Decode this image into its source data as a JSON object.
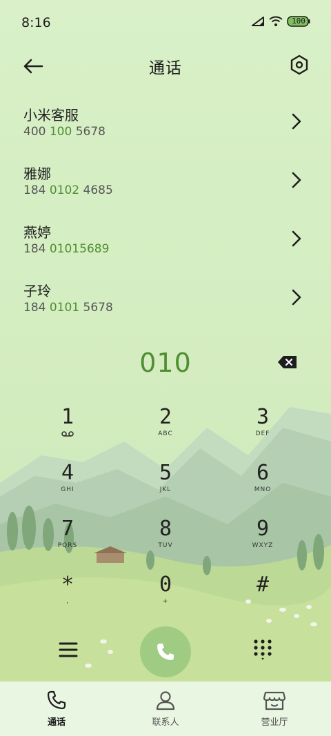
{
  "status_bar": {
    "time": "8:16",
    "battery": "100",
    "icons": [
      "signal-icon",
      "wifi-icon",
      "battery-icon"
    ]
  },
  "header": {
    "title": "通话",
    "back_icon": "arrow-left-icon",
    "settings_icon": "settings-hexagon-icon"
  },
  "contacts": [
    {
      "name": "小米客服",
      "number_pre": "400 ",
      "number_match": "100",
      "number_post": " 5678"
    },
    {
      "name": "雅娜",
      "number_pre": "184 ",
      "number_match": "0102",
      "number_post": " 4685"
    },
    {
      "name": "燕婷",
      "number_pre": "184 ",
      "number_match": "01015689",
      "number_post": ""
    },
    {
      "name": "子玲",
      "number_pre": "184 ",
      "number_match": "0101",
      "number_post": " 5678"
    }
  ],
  "dialer": {
    "number": "010",
    "keys": [
      {
        "digit": "1",
        "sub": ""
      },
      {
        "digit": "2",
        "sub": "ABC"
      },
      {
        "digit": "3",
        "sub": "DEF"
      },
      {
        "digit": "4",
        "sub": "GHI"
      },
      {
        "digit": "5",
        "sub": "JKL"
      },
      {
        "digit": "6",
        "sub": "MNO"
      },
      {
        "digit": "7",
        "sub": "PQRS"
      },
      {
        "digit": "8",
        "sub": "TUV"
      },
      {
        "digit": "9",
        "sub": "WXYZ"
      },
      {
        "digit": "*",
        "sub": ","
      },
      {
        "digit": "0",
        "sub": "+"
      },
      {
        "digit": "#",
        "sub": ""
      }
    ]
  },
  "bottom_nav": {
    "items": [
      {
        "label": "通话",
        "icon": "phone-icon",
        "active": true
      },
      {
        "label": "联系人",
        "icon": "person-icon",
        "active": false
      },
      {
        "label": "营业厅",
        "icon": "store-icon",
        "active": false
      }
    ]
  },
  "colors": {
    "background": "#d6efc4",
    "accent": "#4f8f32",
    "call_button": "#9fcc82"
  }
}
